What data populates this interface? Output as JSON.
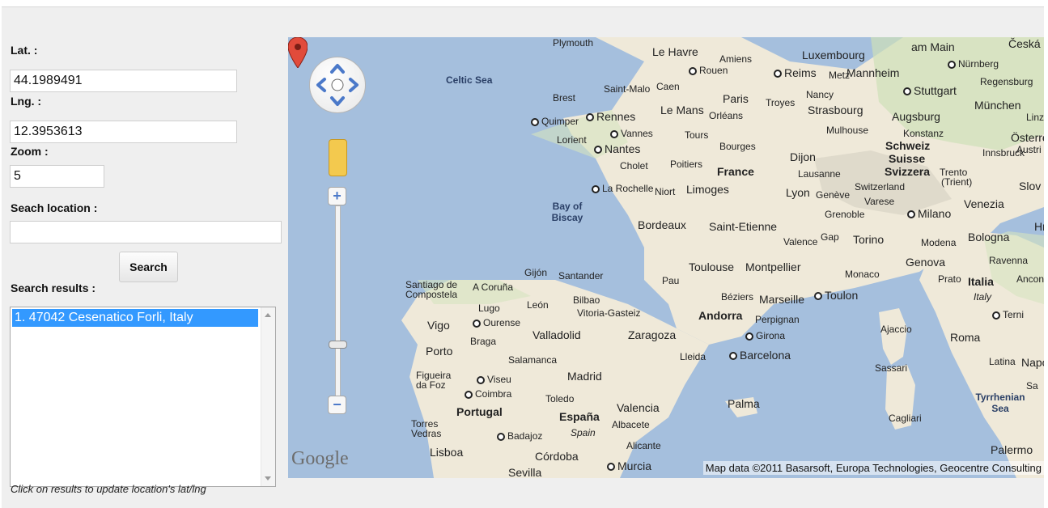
{
  "form": {
    "lat_label": "Lat. :",
    "lat_value": "44.1989491",
    "lng_label": "Lng. :",
    "lng_value": "12.3953613",
    "zoom_label": "Zoom :",
    "zoom_value": "5",
    "search_label": "Seach location :",
    "search_value": "",
    "search_button": "Search",
    "results_label": "Search results :",
    "results": [
      "1. 47042 Cesenatico Forli, Italy"
    ],
    "hint": "Click on results to update location's lat/lng"
  },
  "map": {
    "logo": "Google",
    "attribution": "Map data ©2011 Basarsoft, Europa Technologies, Geocentre Consulting",
    "labels": {
      "plymouth": "Plymouth",
      "le_havre": "Le Havre",
      "amiens": "Amiens",
      "luxembourg": "Luxembourg",
      "am_main": "am Main",
      "ceska": "Česká",
      "celtic_sea": "Celtic Sea",
      "rouen": "Rouen",
      "reims": "Reims",
      "metz": "Metz",
      "mannheim": "Mannheim",
      "nurnberg": "Nürnberg",
      "regensburg": "Regensburg",
      "saint_malo": "Saint-Malo",
      "caen": "Caen",
      "paris": "Paris",
      "stuttgart": "Stuttgart",
      "brest": "Brest",
      "le_mans": "Le Mans",
      "troyes": "Troyes",
      "nancy": "Nancy",
      "strasbourg": "Strasbourg",
      "munchen": "München",
      "quimper": "Quimper",
      "rennes": "Rennes",
      "orleans": "Orléans",
      "augsburg": "Augsburg",
      "lorient": "Lorient",
      "vannes": "Vannes",
      "tours": "Tours",
      "mulhouse": "Mulhouse",
      "konstanz": "Konstanz",
      "nantes": "Nantes",
      "bourges": "Bourges",
      "dijon": "Dijon",
      "schweiz": "Schweiz",
      "suisse": "Suisse",
      "svizzera": "Svizzera",
      "cholet": "Cholet",
      "poitiers": "Poitiers",
      "france": "France",
      "lausanne": "Lausanne",
      "trento": "Trento",
      "la_rochelle": "La Rochelle",
      "niort": "Niort",
      "limoges": "Limoges",
      "lyon": "Lyon",
      "geneve": "Genève",
      "switzerland": "Switzerland",
      "venezia": "Venezia",
      "bay_of_biscay": "Bay of Biscay",
      "varese": "Varese",
      "grenoble": "Grenoble",
      "milano": "Milano",
      "bordeaux": "Bordeaux",
      "saint_etienne": "Saint-Etienne",
      "torino": "Torino",
      "modena": "Modena",
      "bologna": "Bologna",
      "valence": "Valence",
      "gap": "Gap",
      "genova": "Genova",
      "ravenna": "Ravenna",
      "gijon": "Gijón",
      "santander": "Santander",
      "toulouse": "Toulouse",
      "montpellier": "Montpellier",
      "monaco": "Monaco",
      "prato": "Prato",
      "italia": "Italia",
      "italy": "Italy",
      "santiago": "Santiago de Compostela",
      "a_coruna": "A Coruña",
      "pau": "Pau",
      "beziers": "Béziers",
      "marseille": "Marseille",
      "toulon": "Toulon",
      "lugo": "Lugo",
      "leon": "León",
      "bilbao": "Bilbao",
      "vitoria": "Vitoria-Gasteiz",
      "andorra": "Andorra",
      "perpignan": "Perpignan",
      "vigo": "Vigo",
      "ourense": "Ourense",
      "ajaccio": "Ajaccio",
      "terni": "Terni",
      "braga": "Braga",
      "valladolid": "Valladolid",
      "zaragoza": "Zaragoza",
      "girona": "Girona",
      "roma": "Roma",
      "porto": "Porto",
      "lleida": "Lleida",
      "barcelona": "Barcelona",
      "salamanca": "Salamanca",
      "sassari": "Sassari",
      "latina": "Latina",
      "napoli": "Napo",
      "figueira": "Figueira da Foz",
      "viseu": "Viseu",
      "madrid": "Madrid",
      "coimbra": "Coimbra",
      "toledo": "Toledo",
      "palma": "Palma",
      "tyrrhenian_sea": "Tyrrhenian Sea",
      "portugal": "Portugal",
      "valencia": "Valencia",
      "espana": "España",
      "spain": "Spain",
      "torres_vedras": "Torres Vedras",
      "badajoz": "Badajoz",
      "albacete": "Albacete",
      "cagliari": "Cagliari",
      "lisboa": "Lisboa",
      "alicante": "Alicante",
      "cordoba": "Córdoba",
      "sevilla": "Sevilla",
      "murcia": "Murcia",
      "palermo": "Palermo",
      "slov": "Slov",
      "linz": "Linz",
      "osterr": "Österre",
      "austri": "Austri",
      "innsbruck": "Innsbruck",
      "trient": "(Trient)",
      "hr": "Hr",
      "ancona": "Ancona",
      "sa": "Sa"
    }
  }
}
